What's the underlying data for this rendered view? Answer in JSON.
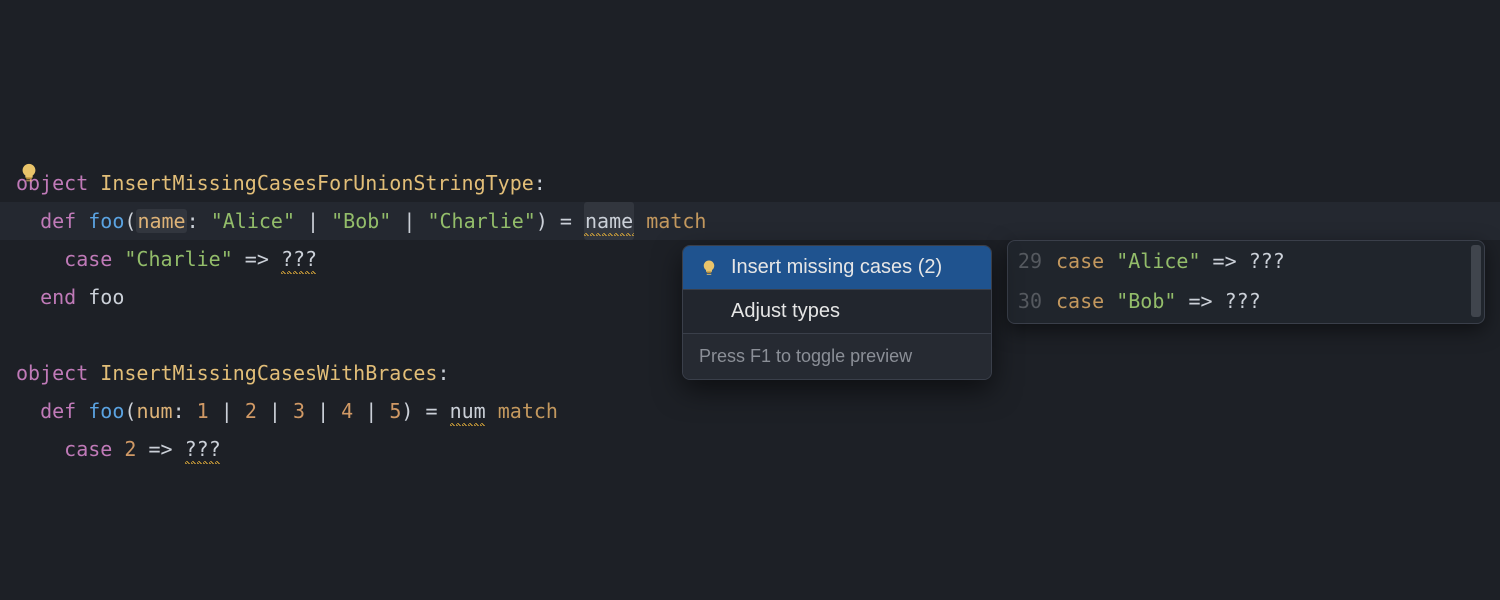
{
  "code": {
    "block1": {
      "objectKw": "object",
      "objectName": "InsertMissingCasesForUnionStringType",
      "objectColon": ":",
      "defKw": "def",
      "fnName": "foo",
      "lparen": "(",
      "paramName": "name",
      "paramColon": ": ",
      "str1": "\"Alice\"",
      "pipe1": " | ",
      "str2": "\"Bob\"",
      "pipe2": " | ",
      "str3": "\"Charlie\"",
      "rparen": ")",
      "eq": " = ",
      "refName": "name",
      "space": " ",
      "matchKw": "match",
      "caseKw": "case",
      "caseStr": "\"Charlie\"",
      "arrow": " => ",
      "unknown": "???",
      "endKw": "end",
      "endName": "foo"
    },
    "block2": {
      "objectKw": "object",
      "objectName": "InsertMissingCasesWithBraces",
      "objectColon": ":",
      "defKw": "def",
      "fnName": "foo",
      "lparen": "(",
      "paramName": "num",
      "paramColon": ": ",
      "n1": "1",
      "p1": " | ",
      "n2": "2",
      "p2": " | ",
      "n3": "3",
      "p3": " | ",
      "n4": "4",
      "p4": " | ",
      "n5": "5",
      "rparen": ")",
      "eq": " = ",
      "refName": "num",
      "space": " ",
      "matchKw": "match",
      "caseKw": "case",
      "caseNum": "2",
      "arrow": " => ",
      "unknown": "???"
    }
  },
  "popup": {
    "items": [
      {
        "label": "Insert missing cases (2)",
        "selected": true,
        "hasBulb": true
      },
      {
        "label": "Adjust types",
        "selected": false,
        "hasBulb": false
      }
    ],
    "hint": "Press F1 to toggle preview"
  },
  "preview": {
    "lines": [
      {
        "num": "29",
        "caseKw": "case",
        "sp1": " ",
        "str": "\"Alice\"",
        "arrow": " => ",
        "unknown": "???"
      },
      {
        "num": "30",
        "caseKw": "case",
        "sp1": " ",
        "str": "\"Bob\"",
        "arrow": " => ",
        "unknown": "???"
      }
    ]
  },
  "icons": {
    "bulb": "lightbulb-icon"
  }
}
